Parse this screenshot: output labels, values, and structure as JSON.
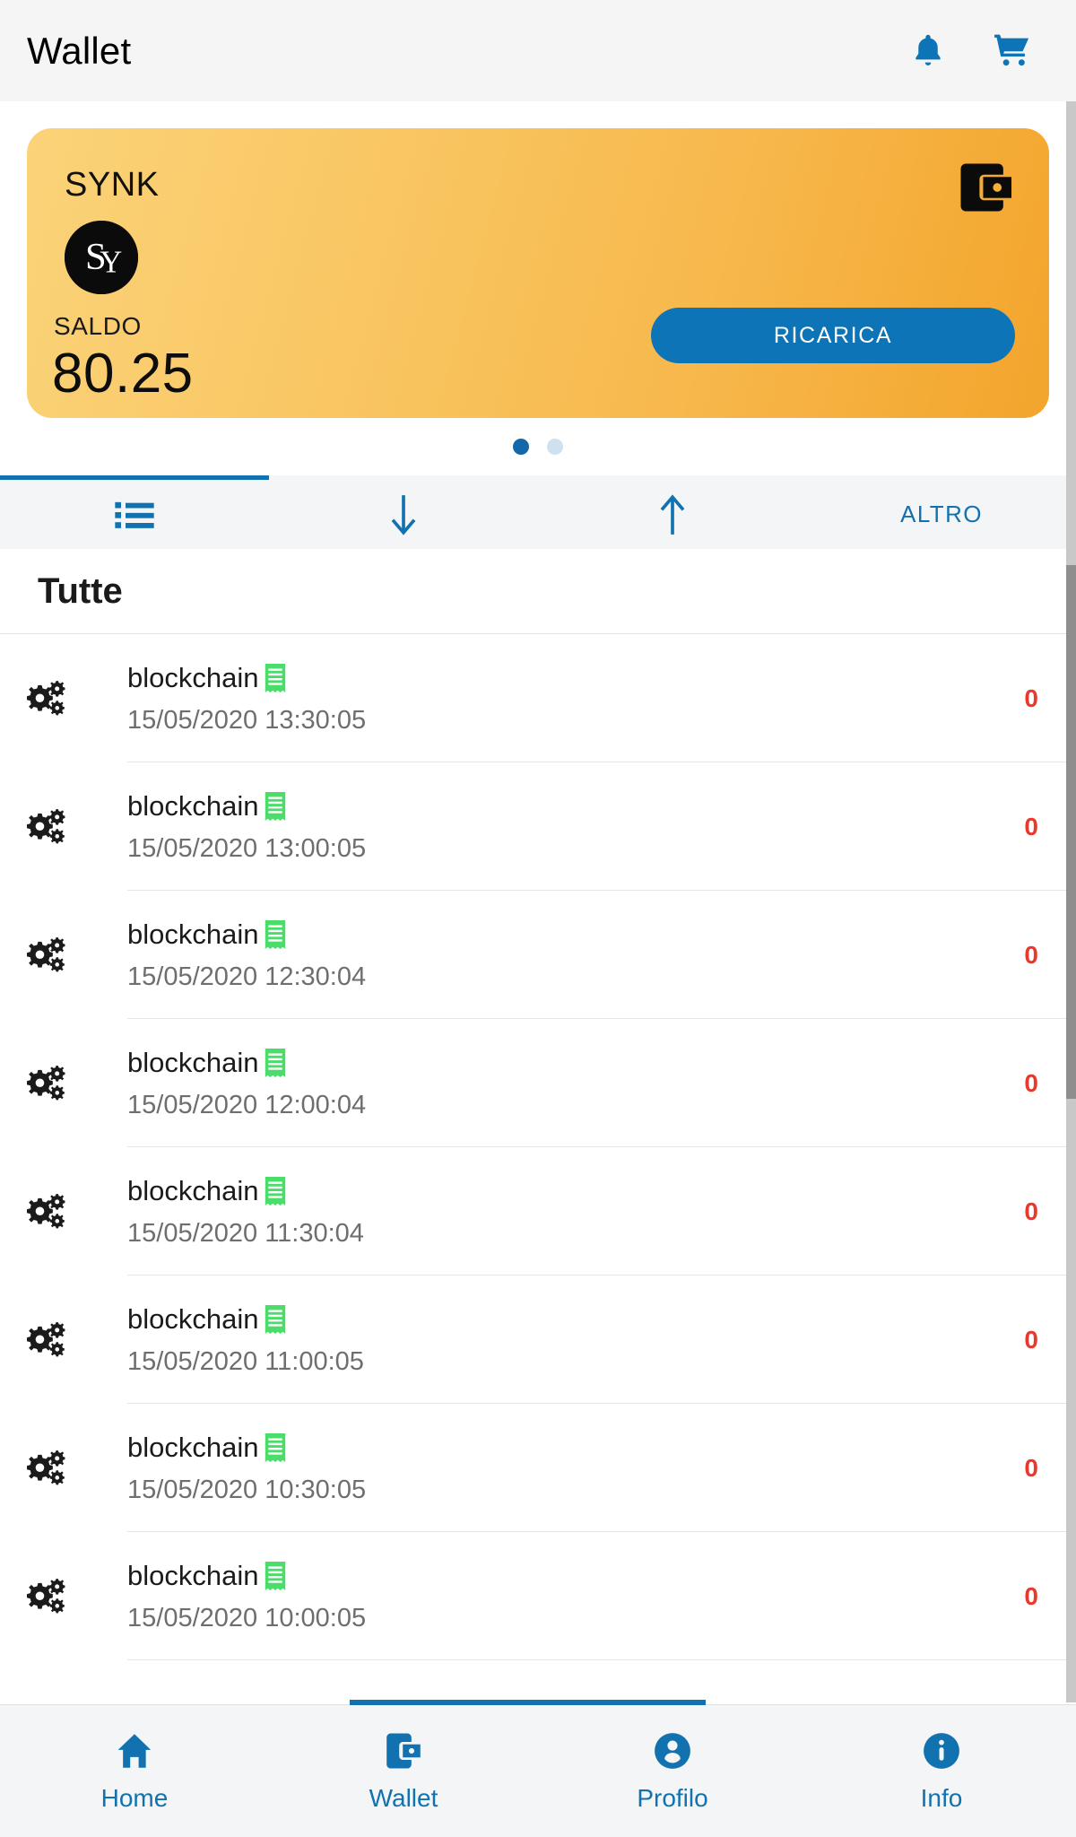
{
  "header": {
    "title": "Wallet",
    "icons": [
      {
        "name": "notifications-bell-icon",
        "label": "Notifiche"
      },
      {
        "name": "shopping-cart-icon",
        "label": "Carrello"
      }
    ]
  },
  "card": {
    "brand": "SYNK",
    "logo_text": "SY",
    "wallet_icon": "wallet-icon",
    "balance_label": "SALDO",
    "balance_value": "80.25",
    "topup_button": "RICARICA",
    "gradient_from": "#FBD379",
    "gradient_to": "#F3A52C",
    "button_color": "#0D74B8"
  },
  "carousel": {
    "dots": 2,
    "active_index": 0,
    "active_color": "#1368AB",
    "inactive_color": "#CFE1EE"
  },
  "tabs": {
    "active_index": 0,
    "accent": "#1272B0",
    "items": [
      {
        "name": "tab-all",
        "icon": "list-icon",
        "label": ""
      },
      {
        "name": "tab-incoming",
        "icon": "arrow-down-icon",
        "label": ""
      },
      {
        "name": "tab-outgoing",
        "icon": "arrow-up-icon",
        "label": ""
      },
      {
        "name": "tab-more",
        "icon": "",
        "label": "ALTRO"
      }
    ]
  },
  "section": {
    "title": "Tutte"
  },
  "transactions": [
    {
      "icon": "gears-icon",
      "title": "blockchain",
      "badge": "receipt-icon",
      "date": "15/05/2020 13:30:05",
      "amount": "0"
    },
    {
      "icon": "gears-icon",
      "title": "blockchain",
      "badge": "receipt-icon",
      "date": "15/05/2020 13:00:05",
      "amount": "0"
    },
    {
      "icon": "gears-icon",
      "title": "blockchain",
      "badge": "receipt-icon",
      "date": "15/05/2020 12:30:04",
      "amount": "0"
    },
    {
      "icon": "gears-icon",
      "title": "blockchain",
      "badge": "receipt-icon",
      "date": "15/05/2020 12:00:04",
      "amount": "0"
    },
    {
      "icon": "gears-icon",
      "title": "blockchain",
      "badge": "receipt-icon",
      "date": "15/05/2020 11:30:04",
      "amount": "0"
    },
    {
      "icon": "gears-icon",
      "title": "blockchain",
      "badge": "receipt-icon",
      "date": "15/05/2020 11:00:05",
      "amount": "0"
    },
    {
      "icon": "gears-icon",
      "title": "blockchain",
      "badge": "receipt-icon",
      "date": "15/05/2020 10:30:05",
      "amount": "0"
    },
    {
      "icon": "gears-icon",
      "title": "blockchain",
      "badge": "receipt-icon",
      "date": "15/05/2020 10:00:05",
      "amount": "0"
    }
  ],
  "amount_color": "#E8392C",
  "bottom_nav": {
    "active_index": 1,
    "accent": "#1272B0",
    "items": [
      {
        "name": "nav-home",
        "icon": "home-icon",
        "label": "Home"
      },
      {
        "name": "nav-wallet",
        "icon": "wallet-icon",
        "label": "Wallet"
      },
      {
        "name": "nav-profile",
        "icon": "person-icon",
        "label": "Profilo"
      },
      {
        "name": "nav-info",
        "icon": "info-icon",
        "label": "Info"
      }
    ]
  }
}
